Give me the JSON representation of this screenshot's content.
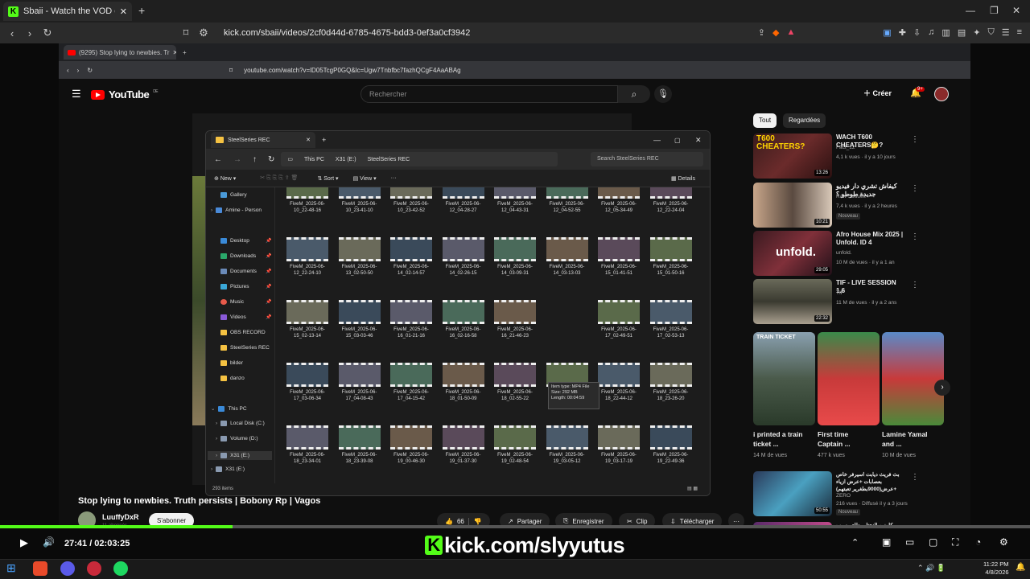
{
  "browser": {
    "tab_title": "Sbaii - Watch the VOD on Kic",
    "url": "kick.com/sbaii/videos/2cf0d44d-6785-4675-bdd3-0ef3a0cf3942",
    "badge": "120"
  },
  "inner": {
    "tab_title": "(9295) Stop lying to newbies. Tr",
    "url": "youtube.com/watch?v=lD05TcgP0GQ&lc=Ugw7Tnbfbc7fazhQCgF4AaABAg"
  },
  "youtube": {
    "logo": "YouTube",
    "region": "DE",
    "search_placeholder": "Rechercher",
    "create": "Créer",
    "notif": "9+"
  },
  "chips": [
    "Tout",
    "Regardées"
  ],
  "recs": [
    {
      "title": "WACH T600 CHEATERS🤔?",
      "channel": "Fact_12",
      "meta": "4,1 k vues · il y a 10 jours",
      "dur": "13:26",
      "thumb_text": "T600 CHEATERS?"
    },
    {
      "title": "كيفاش تشري دار فيديو جديدة طوطو ؟",
      "channel": "Raw Souuelt",
      "meta": "7,4 k vues · il y a 2 heures",
      "dur": "10:21",
      "badge": "Nouveau"
    },
    {
      "title": "Afro House Mix 2025 | Unfold. ID 4",
      "channel": "unfold.",
      "meta": "10 M de vues · il y a 1 an",
      "dur": "29:05",
      "thumb_text": "unfold."
    },
    {
      "title": "TIF - LIVE SESSION 1.6",
      "channel": "TIF",
      "meta": "11 M de vues · il y a 2 ans",
      "dur": "22:32"
    }
  ],
  "shorts": [
    {
      "title": "i printed a train ticket ...",
      "views": "14 M de vues",
      "tag": "TRAIN TICKET"
    },
    {
      "title": "First time Captain ...",
      "views": "477 k vues"
    },
    {
      "title": "Lamine Yamal and ...",
      "views": "10 M de vues"
    }
  ],
  "rec5": {
    "title": "بث فريث ديابت اسيرفر خاص بعصابات +عرض ازياء +عرض(9000بطغرير تعبتهم)",
    "channel": "ZERO",
    "meta": "216 vues · Diffusé il y a 3 jours",
    "dur": "50:55",
    "badge": "Nouveau"
  },
  "rec6": {
    "title": "كلونين النحتلي طاي يسبب الهندي ج"
  },
  "explorer": {
    "title": "SteelSeries REC",
    "path": [
      "This PC",
      "X31 (E:)",
      "SteelSeries REC"
    ],
    "search": "Search SteelSeries REC",
    "toolbar": {
      "new": "New",
      "sort": "Sort",
      "view": "View",
      "more": "···",
      "details": "Details"
    },
    "sidebar": {
      "gallery": "Gallery",
      "amine": "Amine - Person",
      "desktop": "Desktop",
      "downloads": "Downloads",
      "documents": "Documents",
      "pictures": "Pictures",
      "music": "Music",
      "videos": "Videos",
      "obs": "OBS RECORD",
      "ssrec": "SteelSeries REC",
      "bilder": "bilder",
      "danzo": "danzo",
      "thispc": "This PC",
      "localc": "Local Disk (C:)",
      "volumed": "Volume (D:)",
      "x31": "X31 (E:)",
      "x31b": "X31 (E:)"
    },
    "files": [
      [
        "FiveM_2025-06-10_22-48-16",
        "FiveM_2025-06-10_23-41-10",
        "FiveM_2025-06-10_23-42-52",
        "FiveM_2025-06-12_04-28-27",
        "FiveM_2025-06-12_04-43-31",
        "FiveM_2025-06-12_04-52-55",
        "FiveM_2025-06-12_05-34-49",
        "FiveM_2025-06-12_22-24-04"
      ],
      [
        "FiveM_2025-06-12_22-24-10",
        "FiveM_2025-06-13_02-50-50",
        "FiveM_2025-06-14_02-14-57",
        "FiveM_2025-06-14_02-26-15",
        "FiveM_2025-06-14_03-09-31",
        "FiveM_2025-06-14_03-13-03",
        "FiveM_2025-06-15_01-41-51",
        "FiveM_2025-06-15_01-50-16"
      ],
      [
        "FiveM_2025-06-15_02-13-14",
        "FiveM_2025-06-15_03-03-46",
        "FiveM_2025-06-16_01-21-16",
        "FiveM_2025-06-16_02-16-58",
        "FiveM_2025-06-16_21-46-23",
        "",
        "FiveM_2025-06-17_02-49-51",
        "FiveM_2025-06-17_02-53-13"
      ],
      [
        "FiveM_2025-06-17_03-06-34",
        "FiveM_2025-06-17_04-08-43",
        "FiveM_2025-06-17_04-15-42",
        "FiveM_2025-06-18_01-50-09",
        "FiveM_2025-06-18_02-55-22",
        "FiveM_2025-06-18_03-43-33",
        "FiveM_2025-06-18_22-44-12",
        "FiveM_2025-06-18_23-26-20"
      ],
      [
        "FiveM_2025-06-18_23-34-01",
        "FiveM_2025-06-18_23-39-08",
        "FiveM_2025-06-19_00-46-30",
        "FiveM_2025-06-19_01-37-30",
        "FiveM_2025-06-19_02-48-54",
        "FiveM_2025-06-19_03-05-12",
        "FiveM_2025-06-19_03-17-19",
        "FiveM_2025-06-19_22-49-36"
      ]
    ],
    "tooltip": {
      "l1": "Item type: MP4 File",
      "l2": "Size: 292 MB",
      "l3": "Length: 00:04:59"
    },
    "status": "293 items"
  },
  "video": {
    "title": "Stop lying to newbies. Truth persists | Bobony Rp | Vagos",
    "channel": "LuuffyDxR",
    "subs": "11 abonnés",
    "subscribe": "S'abonner",
    "likes": "66",
    "share": "Partager",
    "save": "Enregistrer",
    "clip": "Clip",
    "download": "Télécharger",
    "more": "···"
  },
  "player": {
    "time": "27:41 / 02:03:25",
    "progress": 0.226,
    "watermark": "kick.com/slyyutus"
  },
  "clock": {
    "time": "11:22 PM",
    "date": "4/8/2026"
  },
  "colors": {
    "kick_green": "#53fc18",
    "yt_red": "#ff0000"
  }
}
